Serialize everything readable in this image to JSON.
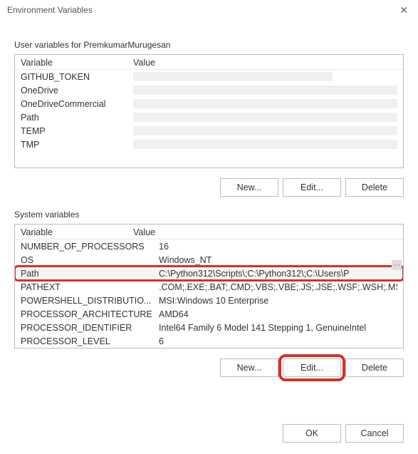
{
  "title": "Environment Variables",
  "close_symbol": "✕",
  "user_section": {
    "label": "User variables for PremkumarMurugesan",
    "headers": {
      "variable": "Variable",
      "value": "Value"
    },
    "rows": [
      {
        "variable": "GITHUB_TOKEN",
        "value": ""
      },
      {
        "variable": "OneDrive",
        "value": ""
      },
      {
        "variable": "OneDriveCommercial",
        "value": ""
      },
      {
        "variable": "Path",
        "value": ""
      },
      {
        "variable": "TEMP",
        "value": ""
      },
      {
        "variable": "TMP",
        "value": ""
      }
    ],
    "buttons": {
      "new": "New...",
      "edit": "Edit...",
      "delete": "Delete"
    }
  },
  "system_section": {
    "label": "System variables",
    "headers": {
      "variable": "Variable",
      "value": "Value"
    },
    "rows": [
      {
        "variable": "NUMBER_OF_PROCESSORS",
        "value": "16"
      },
      {
        "variable": "OS",
        "value": "Windows_NT"
      },
      {
        "variable": "Path",
        "value": "C:\\Python312\\Scripts\\;C:\\Python312\\;C:\\Users\\P"
      },
      {
        "variable": "PATHEXT",
        "value": ".COM;.EXE;.BAT;.CMD;.VBS;.VBE;.JS;.JSE;.WSF;.WSH;.MSC;.PY;.PYW"
      },
      {
        "variable": "POWERSHELL_DISTRIBUTIO...",
        "value": "MSI:Windows 10 Enterprise"
      },
      {
        "variable": "PROCESSOR_ARCHITECTURE",
        "value": "AMD64"
      },
      {
        "variable": "PROCESSOR_IDENTIFIER",
        "value": "Intel64 Family 6 Model 141 Stepping 1, GenuineIntel"
      },
      {
        "variable": "PROCESSOR_LEVEL",
        "value": "6"
      }
    ],
    "buttons": {
      "new": "New...",
      "edit": "Edit...",
      "delete": "Delete"
    }
  },
  "footer": {
    "ok": "OK",
    "cancel": "Cancel"
  }
}
